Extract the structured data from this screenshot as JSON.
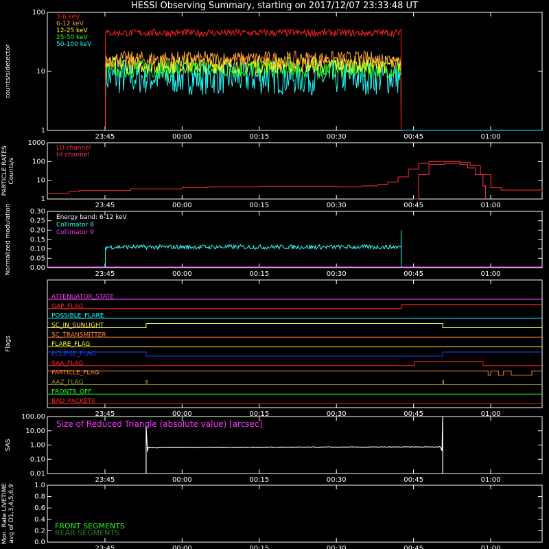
{
  "title": "HESSI Observing Summary, starting on 2017/12/07 23:33:48 UT",
  "time_axis": {
    "start": "23:33:48",
    "end": "01:10:00",
    "ticks": [
      "23:45",
      "00:00",
      "00:15",
      "00:30",
      "00:45",
      "01:00"
    ]
  },
  "chart_data": [
    {
      "panel": "count rates",
      "type": "line",
      "ylabel": "counts/s/detector",
      "yscale": "log",
      "ylim": [
        1,
        100
      ],
      "yticks": [
        "1",
        "10",
        "100"
      ],
      "data_start": "23:45:05",
      "data_end": "00:42:35",
      "series": [
        {
          "name": "3-6 keV",
          "color": "#ff2020",
          "level": 45,
          "noise": 0.06
        },
        {
          "name": "6-12 keV",
          "color": "#ffa030",
          "level": 16,
          "noise": 0.14
        },
        {
          "name": "12-25 keV",
          "color": "#ffff20",
          "level": 13,
          "noise": 0.15
        },
        {
          "name": "25-50 keV",
          "color": "#20ff20",
          "level": 11,
          "noise": 0.16
        },
        {
          "name": "50-100 keV",
          "color": "#20ffff",
          "level": 8,
          "noise": 0.3
        }
      ]
    },
    {
      "panel": "particle rates",
      "type": "line",
      "ylabel": "PARTICLE RATES Counts/s",
      "yscale": "log",
      "ylim": [
        1,
        1000
      ],
      "yticks": [
        "1",
        "10",
        "100",
        "1000"
      ],
      "series": [
        {
          "name": "LO channel",
          "color": "#ff3030",
          "times": [
            "23:33:48",
            "23:38:00",
            "23:40:00",
            "23:50:00",
            "00:00:00",
            "00:05:00",
            "00:15:00",
            "00:25:00",
            "00:30:00",
            "00:35:00",
            "00:38:00",
            "00:40:00",
            "00:42:00",
            "00:44:00",
            "00:46:00",
            "00:48:00",
            "00:51:00",
            "00:54:00",
            "00:56:00",
            "00:58:00",
            "01:00:00",
            "01:02:00",
            "01:10:00"
          ],
          "values": [
            2,
            2.5,
            2.8,
            3.5,
            4,
            4.5,
            4.8,
            4.8,
            4.5,
            5,
            6,
            8,
            15,
            40,
            80,
            100,
            100,
            90,
            60,
            20,
            4,
            3,
            2.5
          ]
        },
        {
          "name": "HI channel",
          "color": "#ff3070",
          "times": [
            "00:45:00",
            "00:46:00",
            "00:48:00",
            "00:51:00",
            "00:54:00",
            "00:55:30",
            "00:57:00",
            "00:58:30",
            "00:59:00"
          ],
          "values": [
            1,
            20,
            70,
            80,
            70,
            45,
            20,
            5,
            1
          ]
        }
      ]
    },
    {
      "panel": "modulation",
      "type": "line",
      "ylabel": "Normalized modulation",
      "ylim": [
        0,
        0.3
      ],
      "yticks": [
        "0.00",
        "0.05",
        "0.10",
        "0.15",
        "0.20",
        "0.25",
        "0.30"
      ],
      "legend_title": "Energy band: 6-12 keV",
      "data_start": "23:45:05",
      "data_end": "00:42:35",
      "series": [
        {
          "name": "Collimator 8",
          "color": "#30ffff",
          "level": 0.11,
          "noise": 0.012
        },
        {
          "name": "Collimator 9",
          "color": "#ff30ff",
          "level": 0.0
        }
      ]
    },
    {
      "panel": "flags",
      "type": "line",
      "ylabel": "Flags",
      "series": [
        {
          "name": "ATTENUATOR_STATE",
          "color": "#ff40ff",
          "changes": []
        },
        {
          "name": "GAP_FLAG",
          "color": "#ff2020",
          "changes": [
            [
              "00:42:35",
              1
            ]
          ]
        },
        {
          "name": "POSSIBLE_FLARE",
          "color": "#20ffff",
          "changes": []
        },
        {
          "name": "SC_IN_SUNLIGHT",
          "color": "#ffff40",
          "changes": [
            [
              "23:53:00",
              1
            ],
            [
              "00:50:40",
              0
            ]
          ]
        },
        {
          "name": "SC_TRANSMITTER",
          "color": "#ff8030",
          "changes": []
        },
        {
          "name": "FLARE_FLAG",
          "color": "#ffff20",
          "changes": []
        },
        {
          "name": "ECLIPSE_FLAG",
          "color": "#2040ff",
          "initial": 1,
          "changes": [
            [
              "23:53:00",
              0
            ],
            [
              "00:50:40",
              1
            ]
          ]
        },
        {
          "name": "SAA_FLAG",
          "color": "#ff2020",
          "changes": [
            [
              "00:45:10",
              1
            ],
            [
              "00:58:30",
              0
            ]
          ]
        },
        {
          "name": "PARTICLE_FLAG",
          "color": "#ff8020",
          "initial": 1,
          "changes": [
            [
              "00:59:30",
              0
            ],
            [
              "01:00:00",
              1
            ],
            [
              "01:01:30",
              0
            ],
            [
              "01:02:30",
              1
            ],
            [
              "01:04:00",
              0
            ],
            [
              "01:08:00",
              1
            ]
          ]
        },
        {
          "name": "AAZ_FLAG",
          "color": "#a09020",
          "spikes": [
            "23:53:00",
            "00:50:40"
          ]
        },
        {
          "name": "FRONTS_OFF",
          "color": "#20ff20",
          "changes": []
        },
        {
          "name": "BAD_PACKETS",
          "color": "#ff2020",
          "changes": []
        }
      ]
    },
    {
      "panel": "SAS",
      "type": "line",
      "ylabel": "SAS",
      "yscale": "log",
      "ylim": [
        0.01,
        100
      ],
      "yticks": [
        "0.01",
        "0.10",
        "1.00",
        "10.00",
        "100.00"
      ],
      "label": "Size of Reduced Triangle (absolute value) [arcsec]",
      "label_color": "#ff30ff",
      "data_start": "23:53:00",
      "data_end": "00:50:40",
      "series": [
        {
          "name": "SAS",
          "color": "#ffffff",
          "level": 0.7
        }
      ]
    },
    {
      "panel": "livetime",
      "type": "line",
      "ylabel": "Mon. Rate LIVETIME avg of D1,3,4,5,6,9",
      "ylim": [
        0,
        1
      ],
      "yticks": [
        "0.0",
        "0.2",
        "0.4",
        "0.6",
        "0.8",
        "1.0"
      ],
      "series": [
        {
          "name": "FRONT SEGMENTS",
          "color": "#20ff20"
        },
        {
          "name": "REAR SEGMENTS",
          "color": "#208020"
        }
      ]
    }
  ]
}
